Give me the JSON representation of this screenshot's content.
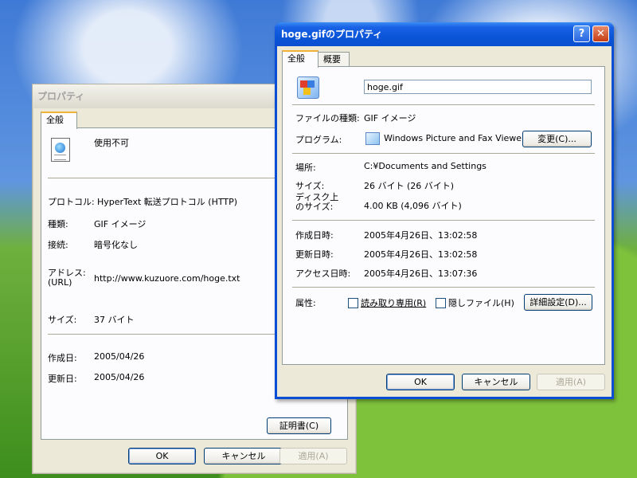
{
  "back_window": {
    "title": "プロパティ",
    "tab": "全般",
    "doc_name": "使用不可",
    "rows": [
      {
        "label": "プロトコル:",
        "value": "HyperText 転送プロトコル (HTTP)"
      },
      {
        "label": "種類:",
        "value": "GIF イメージ"
      },
      {
        "label": "接続:",
        "value": "暗号化なし"
      },
      {
        "label": "アドレス:\n(URL)",
        "value": "http://www.kuzuore.com/hoge.txt"
      },
      {
        "label": "サイズ:",
        "value": "37 バイト"
      },
      {
        "label": "作成日:",
        "value": "2005/04/26"
      },
      {
        "label": "更新日:",
        "value": "2005/04/26"
      }
    ],
    "cert_button": "証明書(C)",
    "ok": "OK",
    "cancel": "キャンセル",
    "apply": "適用(A)"
  },
  "front_window": {
    "title": "hoge.gifのプロパティ",
    "help_glyph": "?",
    "close_glyph": "✕",
    "tabs": [
      "全般",
      "概要"
    ],
    "filename": "hoge.gif",
    "type_label": "ファイルの種類:",
    "type_value": "GIF イメージ",
    "program_label": "プログラム:",
    "program_value": "Windows Picture and Fax Viewer",
    "change_button": "変更(C)...",
    "location_label": "場所:",
    "location_value": "C:¥Documents and Settings",
    "size_label": "サイズ:",
    "size_value": "26 バイト (26 バイト)",
    "disk_size_label_1": "ディスク上",
    "disk_size_label_2": "のサイズ:",
    "disk_size_value": "4.00 KB (4,096 バイト)",
    "created_label": "作成日時:",
    "created_value": "2005年4月26日、13:02:58",
    "modified_label": "更新日時:",
    "modified_value": "2005年4月26日、13:02:58",
    "accessed_label": "アクセス日時:",
    "accessed_value": "2005年4月26日、13:07:36",
    "attr_label": "属性:",
    "readonly_label": "読み取り専用(R)",
    "hidden_label": "隠しファイル(H)",
    "advanced_button": "詳細設定(D)...",
    "ok": "OK",
    "cancel": "キャンセル",
    "apply": "適用(A)"
  }
}
